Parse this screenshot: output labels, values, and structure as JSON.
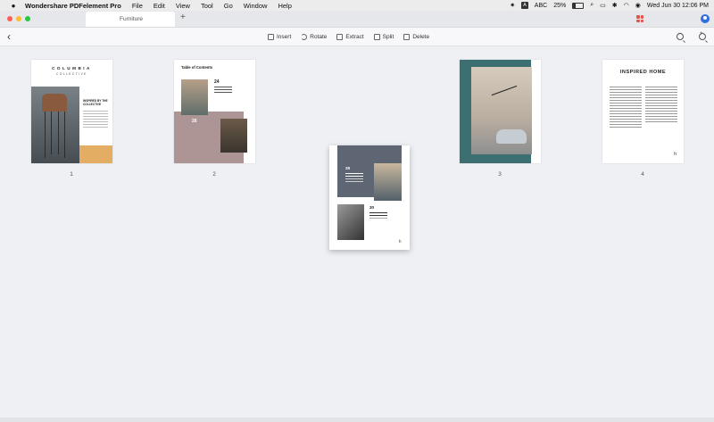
{
  "menubar": {
    "app_name": "Wondershare PDFelement Pro",
    "menus": [
      "File",
      "Edit",
      "View",
      "Tool",
      "Go",
      "Window",
      "Help"
    ],
    "input_source": "ABC",
    "battery": "25%",
    "clock": "Wed Jun 30  12:06 PM"
  },
  "tab": {
    "title": "Furniture",
    "new_tab": "+"
  },
  "toolbar": {
    "insert": "Insert",
    "rotate": "Rotate",
    "extract": "Extract",
    "split": "Split",
    "delete": "Delete"
  },
  "pages": {
    "p1": {
      "brand": "COLUMBIA",
      "brand_sub": "COLLECTIVE",
      "heading": "INSPIRED BY THE COLLECTIVE",
      "number": "1"
    },
    "p2": {
      "toc": "Table of Contents",
      "n1": "24",
      "n2": "26",
      "number": "2"
    },
    "floating": {
      "n1": "28",
      "n2": "30",
      "logo": "h"
    },
    "p3": {
      "number": "3"
    },
    "p4": {
      "title": "INSPIRED HOME",
      "logo": "h",
      "number": "4"
    }
  }
}
